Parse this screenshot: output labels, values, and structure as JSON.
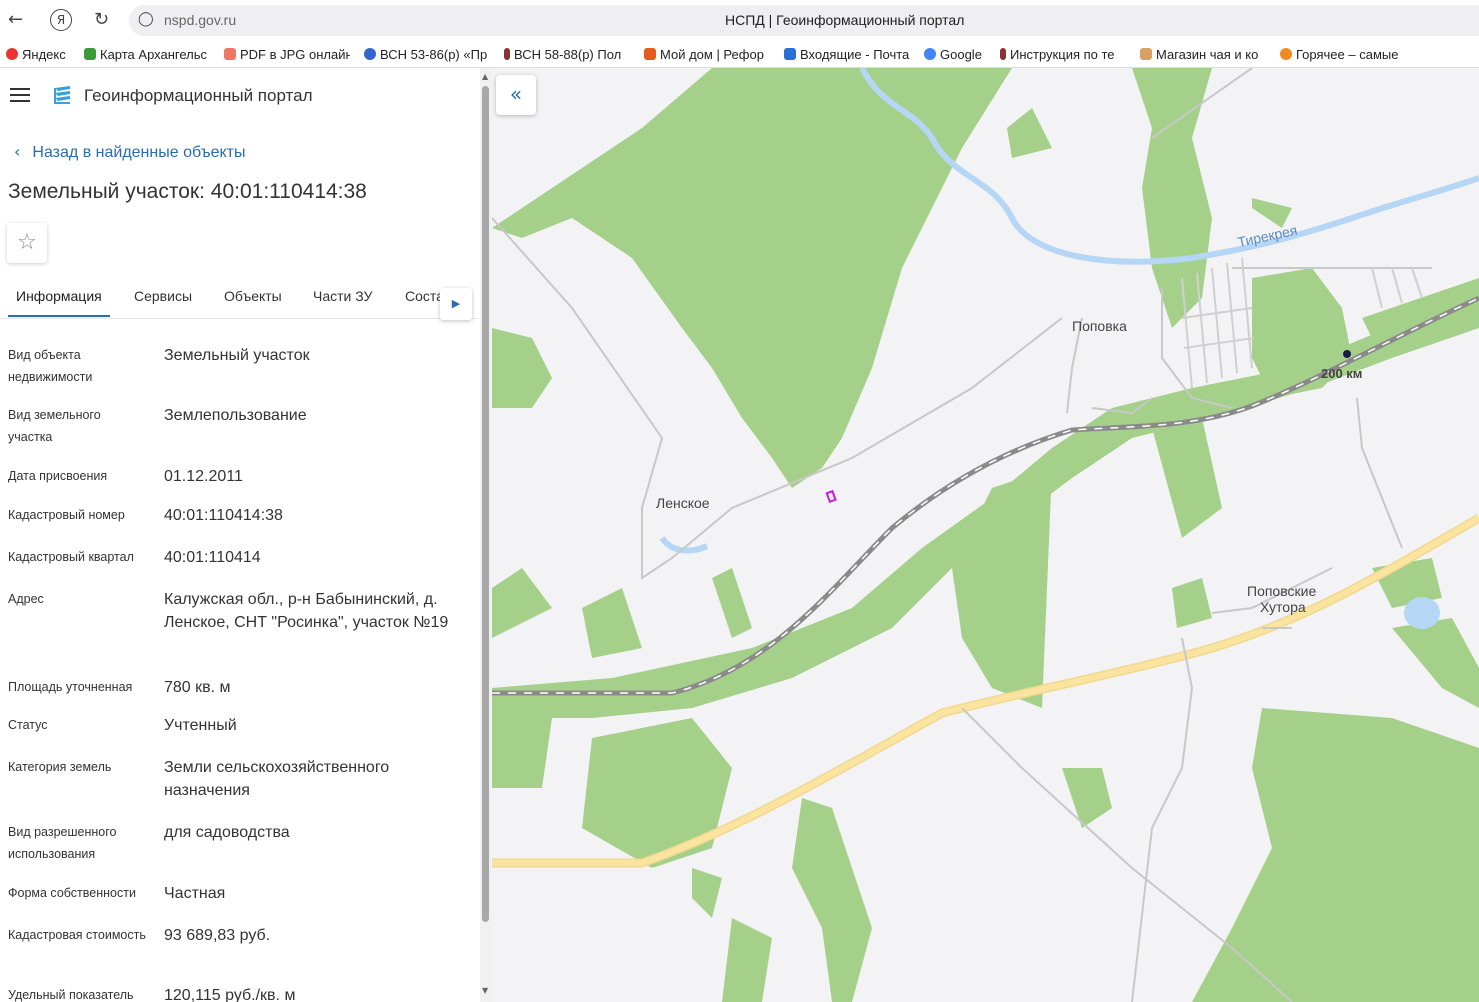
{
  "browser": {
    "url": "nspd.gov.ru",
    "page_title": "НСПД | Геоинформационный портал",
    "bookmarks": [
      "Яндекс",
      "Карта Архангельс",
      "PDF в JPG онлайн",
      "ВСН 53-86(р) «Пр",
      "ВСН 58-88(р) Пол",
      "Мой дом | Рефор",
      "Входящие - Почта",
      "Google",
      "Инструкция по те",
      "Магазин чая и ко",
      "Горячее – самые"
    ]
  },
  "panel": {
    "portal_title": "Геоинформационный портал",
    "back_link": "Назад в найденные объекты",
    "object_title": "Земельный участок: 40:01:110414:38",
    "tabs": [
      "Информация",
      "Сервисы",
      "Объекты",
      "Части ЗУ",
      "Соста"
    ],
    "fields": [
      {
        "label": "Вид объекта недвижимости",
        "value": "Земельный участок"
      },
      {
        "label": "Вид земельного участка",
        "value": "Землепользование"
      },
      {
        "label": "Дата присвоения",
        "value": "01.12.2011"
      },
      {
        "label": "Кадастровый номер",
        "value": "40:01:110414:38"
      },
      {
        "label": "Кадастровый квартал",
        "value": "40:01:110414"
      },
      {
        "label": "Адрес",
        "value": "Калужская обл., р-н Бабынинский, д. Ленское, СНТ \"Росинка\", участок №19"
      },
      {
        "label": "Площадь уточненная",
        "value": "780 кв. м"
      },
      {
        "label": "Статус",
        "value": "Учтенный"
      },
      {
        "label": "Категория земель",
        "value": "Земли сельскохозяйственного назначения"
      },
      {
        "label": "Вид разрешенного использования",
        "value": "для садоводства"
      },
      {
        "label": "Форма собственности",
        "value": "Частная"
      },
      {
        "label": "Кадастровая стоимость",
        "value": "93 689,83 руб."
      },
      {
        "label": "Удельный показатель",
        "value": "120,115 руб./кв. м"
      }
    ]
  },
  "map": {
    "labels": {
      "river": "Тирекрея",
      "popovka": "Поповка",
      "km": "200 км",
      "lenskoe": "Ленское",
      "popovskie": "Поповские",
      "khutora": "Хутора"
    },
    "colors": {
      "forest": "#a5d08a",
      "water": "#b5d6f5",
      "road": "#fbe3a0",
      "railway": "#8a8a8a",
      "parcel": "#c01ed8"
    }
  }
}
